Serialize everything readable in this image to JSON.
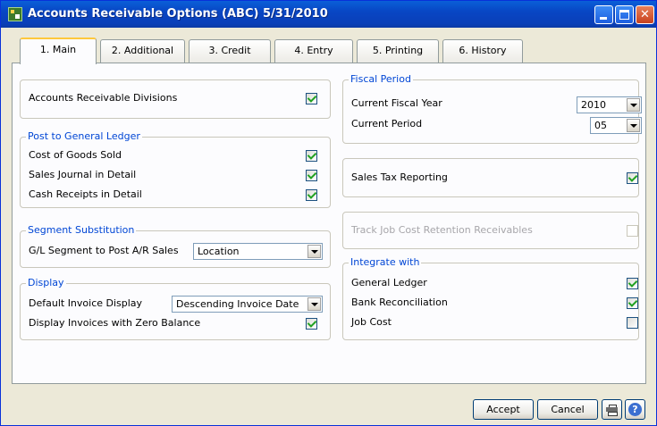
{
  "window": {
    "title": "Accounts Receivable Options (ABC) 5/31/2010",
    "close_glyph": "✕"
  },
  "tabs": [
    {
      "label": "1. Main",
      "active": true
    },
    {
      "label": "2. Additional"
    },
    {
      "label": "3. Credit"
    },
    {
      "label": "4. Entry"
    },
    {
      "label": "5. Printing"
    },
    {
      "label": "6. History"
    }
  ],
  "left": {
    "ar_divisions": {
      "label": "Accounts Receivable Divisions",
      "checked": true
    },
    "post_gl": {
      "title": "Post to General Ledger",
      "cogs": {
        "label": "Cost of Goods Sold",
        "checked": true
      },
      "sales_journal": {
        "label": "Sales Journal in Detail",
        "checked": true
      },
      "cash_receipts": {
        "label": "Cash Receipts in Detail",
        "checked": true
      }
    },
    "segment": {
      "title": "Segment Substitution",
      "label": "G/L Segment to Post A/R Sales",
      "value": "Location"
    },
    "display": {
      "title": "Display",
      "invoice_label": "Default Invoice Display",
      "invoice_value": "Descending Invoice Date",
      "zero_balance": {
        "label": "Display Invoices with Zero Balance",
        "checked": true
      }
    }
  },
  "right": {
    "fiscal": {
      "title": "Fiscal Period",
      "year_label": "Current Fiscal Year",
      "year_value": "2010",
      "period_label": "Current Period",
      "period_value": "05"
    },
    "sales_tax": {
      "label": "Sales Tax Reporting",
      "checked": true
    },
    "job_cost_retention": {
      "label": "Track Job Cost Retention Receivables",
      "checked": false,
      "disabled": true
    },
    "integrate": {
      "title": "Integrate with",
      "general_ledger": {
        "label": "General Ledger",
        "checked": true
      },
      "bank_rec": {
        "label": "Bank Reconciliation",
        "checked": true
      },
      "job_cost": {
        "label": "Job Cost",
        "checked": false
      }
    }
  },
  "buttons": {
    "accept": "Accept",
    "cancel": "Cancel",
    "print_icon": "printer-icon",
    "help_icon": "help-icon",
    "help_glyph": "?"
  }
}
